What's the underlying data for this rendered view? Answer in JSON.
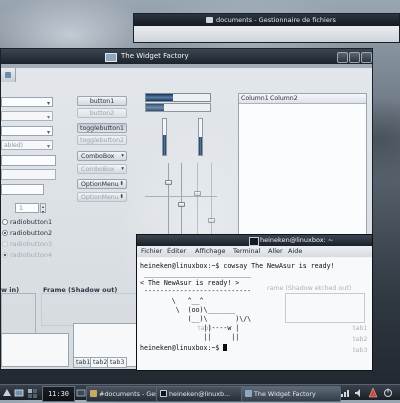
{
  "colors": {
    "accent": "#2a4a75",
    "panel": "#232a32",
    "progress": "#1e3a60"
  },
  "nautilus": {
    "title": "documents - Gestionnaire de fichiers"
  },
  "widget_factory": {
    "title": "The Widget Factory",
    "left_partial": {
      "disabled_fragment": "abled)"
    },
    "spin_value": "1",
    "buttons": {
      "button1": "button1",
      "button2": "button2",
      "togglebutton1": "togglebutton1",
      "togglebutton2": "togglebutton2"
    },
    "combos": [
      {
        "label": "ComboBox",
        "enabled": true
      },
      {
        "label": "ComboBox",
        "enabled": false
      },
      {
        "label": "OptionMenu",
        "enabled": true
      },
      {
        "label": "OptionMenu",
        "enabled": false
      }
    ],
    "radios": [
      {
        "label": "radiobutton1",
        "checked": false,
        "enabled": true
      },
      {
        "label": "radiobutton2",
        "checked": true,
        "enabled": true
      },
      {
        "label": "radiobutton3",
        "checked": false,
        "enabled": false
      },
      {
        "label": "radiobutton4",
        "checked": true,
        "enabled": false
      }
    ],
    "progress_bars": [
      0.42,
      0.28
    ],
    "scales": [
      0.55,
      0.5
    ],
    "tree": {
      "columns": [
        "Column1",
        "Column2"
      ]
    },
    "frames": {
      "shadow_in": "w in)",
      "shadow_out": "Frame (Shadow out)"
    },
    "tabs": [
      "tab1",
      "tab2",
      "tab3"
    ]
  },
  "terminal": {
    "title": "heineken@linuxbox: ~",
    "menu": [
      "Fichier",
      "Éditer",
      "Affichage",
      "Terminal",
      "Aller",
      "Aide"
    ],
    "lines": [
      "heineken@linuxbox:~$ cowsay The NewAsur is ready!",
      " ___________________________",
      "< The NewAsur is ready! >",
      " ---------------------------",
      "        \\   ^__^",
      "         \\  (oo)\\_______",
      "            (__)\\       )\\/\\",
      "                ||----w |",
      "                ||     ||",
      "heineken@linuxbox:~$ "
    ],
    "ghost": {
      "frame_out_etched": "rame (Shadow etched out)",
      "tab1": "tab1",
      "tab2": "tab2",
      "tab3": "tab3",
      "behind_tab1": "tab1"
    }
  },
  "panel": {
    "clock": "11:30",
    "tasks": [
      {
        "label": "#documents - Gest",
        "icon_color": "#c9a766"
      },
      {
        "label": "heineken@linuxb...",
        "icon_color": "#101418"
      },
      {
        "label": "The Widget Factory",
        "icon_color": "#8ea7c2"
      }
    ]
  }
}
